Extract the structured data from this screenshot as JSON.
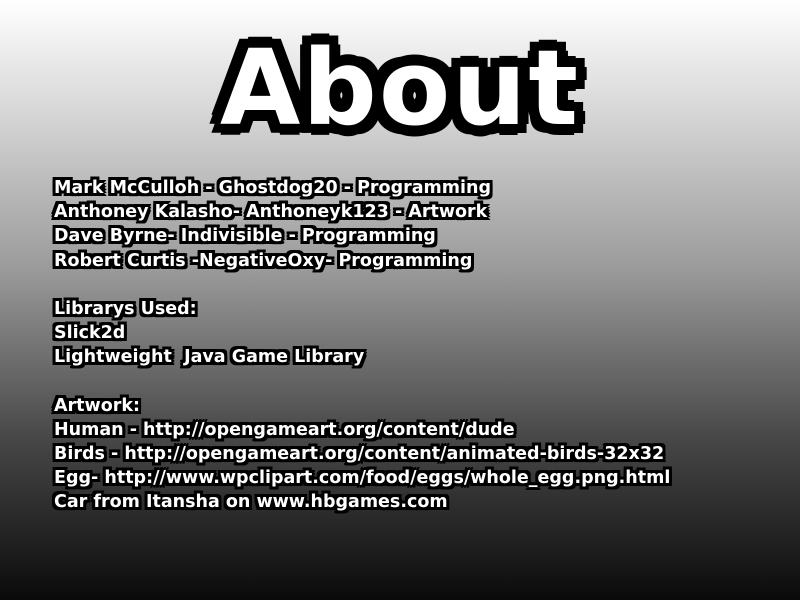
{
  "title": "About",
  "developers": [
    "Mark McCulloh - Ghostdog20 - Programming",
    "Anthoney Kalasho- Anthoneyk123 - Artwork",
    "Dave Byrne- Indivisible - Programming",
    "Robert Curtis -NegativeOxy- Programming"
  ],
  "libraries": {
    "heading": "Librarys Used:",
    "items": [
      "Slick2d",
      "Lightweight  Java Game Library"
    ]
  },
  "artwork": {
    "heading": "Artwork:",
    "items": [
      "Human - http://opengameart.org/content/dude",
      "Birds - http://opengameart.org/content/animated-birds-32x32",
      "Egg- http://www.wpclipart.com/food/eggs/whole_egg.png.html",
      "Car from Itansha on www.hbgames.com"
    ]
  },
  "colors": {
    "text": "#ffffff",
    "outline": "#000000",
    "gradient_top": "#ffffff",
    "gradient_bottom": "#000000"
  }
}
